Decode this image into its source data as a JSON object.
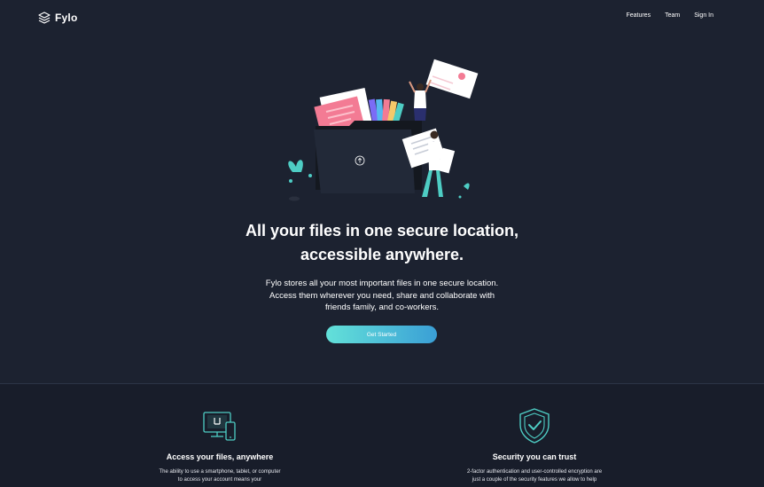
{
  "header": {
    "logo_text": "Fylo",
    "nav": [
      "Features",
      "Team",
      "Sign In"
    ]
  },
  "hero": {
    "title_line1": "All your files in one secure location,",
    "title_line2": "accessible anywhere.",
    "description_line1": "Fylo stores all your most important files in one secure location.",
    "description_line2": "Access them wherever you need, share and collaborate with",
    "description_line3": "friends family, and co-workers.",
    "cta_label": "Get Started"
  },
  "features": [
    {
      "icon": "devices-icon",
      "title": "Access your files, anywhere",
      "desc_line1": "The ability to use a smartphone, tablet, or computer",
      "desc_line2": "to access your account means your"
    },
    {
      "icon": "shield-check-icon",
      "title": "Security you can trust",
      "desc_line1": "2-factor authentication and user-controlled encryption are",
      "desc_line2": "just a couple of the security features we allow to help"
    }
  ],
  "colors": {
    "background": "#1c2230",
    "footer_background": "#181d2a",
    "accent_start": "#63e1d9",
    "accent_end": "#3a9fd6"
  }
}
